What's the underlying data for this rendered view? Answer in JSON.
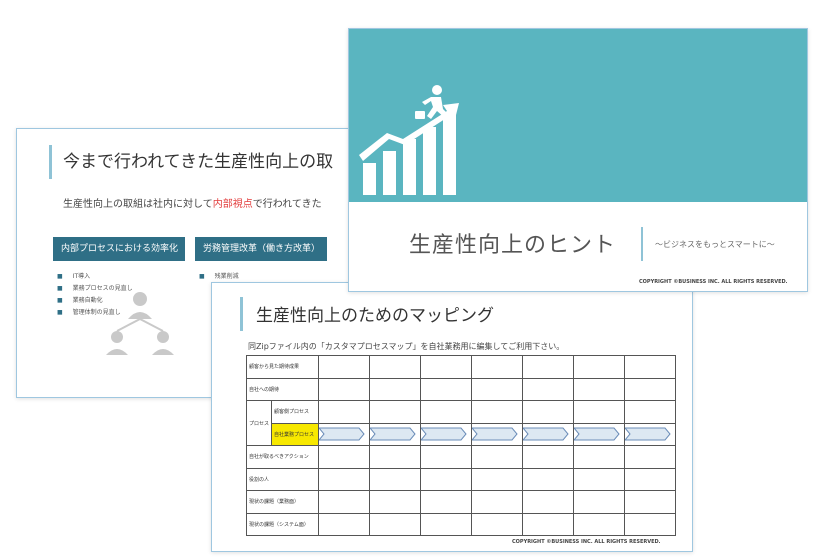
{
  "slideA": {
    "title": "今まで行われてきた生産性向上の取",
    "body_pre": "生産性向上の取組は社内に対して",
    "body_highlight": "内部視点",
    "body_post": "で行われてきた",
    "box1": "内部プロセスにおける効率化",
    "box2": "労務管理改革（働き方改革）",
    "list1": [
      "IT導入",
      "業務プロセスの見直し",
      "業務自動化",
      "管理体制の見直し"
    ],
    "list2": [
      "残業削減"
    ]
  },
  "slideB": {
    "title": "生産性向上のヒント",
    "subtitle": "～ビジネスをもっとスマートに～",
    "copyright": "COPYRIGHT ©BUSINESS INC. ALL RIGHTS RESERVED.",
    "band_color": "#5ab5c0"
  },
  "slideC": {
    "title": "生産性向上のためのマッピング",
    "note": "同Zipファイル内の「カスタマプロセスマップ」を自社業務用に編集してご利用下さい。",
    "row_labels": {
      "r1": "顧客から見た期待成果",
      "r2": "自社への期待",
      "group": "プロセス",
      "r3": "顧客側プロセス",
      "r4": "自社業務プロセス",
      "r5": "自社が取るべきアクション",
      "r6": "役割の人",
      "r7": "現状の課題（業務面）",
      "r8": "現状の課題（システム面）"
    },
    "copyright": "COPYRIGHT ©BUSINESS INC. ALL RIGHTS RESERVED."
  }
}
